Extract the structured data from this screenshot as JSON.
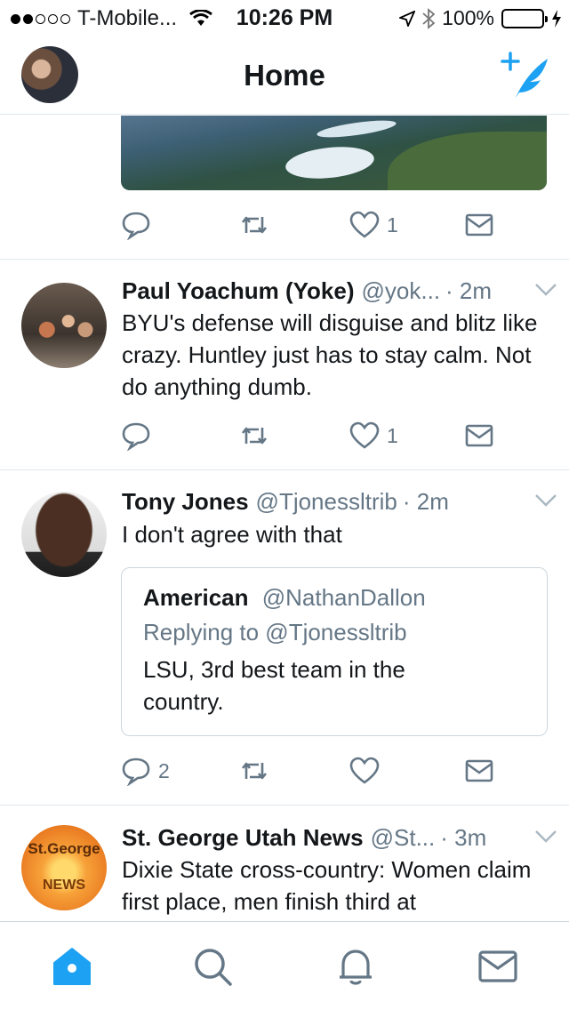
{
  "status_bar": {
    "carrier": "T-Mobile...",
    "time": "10:26 PM",
    "battery": "100%"
  },
  "nav": {
    "title": "Home"
  },
  "top_tweet": {
    "like_count": "1"
  },
  "tweets": [
    {
      "name": "Paul Yoachum (Yoke)",
      "handle": "@yok...",
      "time": "· 2m",
      "body": "BYU's defense will disguise and blitz like crazy. Huntley just has to stay calm. Not do anything dumb.",
      "reply_count": "",
      "like_count": "1"
    },
    {
      "name": "Tony Jones",
      "handle": "@Tjonessltrib",
      "time": "· 2m",
      "body": "I don't agree with that",
      "reply_count": "2",
      "like_count": "",
      "quote": {
        "name": "American",
        "handle": "@NathanDallon",
        "replying": "Replying to @Tjonessltrib",
        "body": "LSU, 3rd best team in the country."
      }
    },
    {
      "name": "St. George Utah News",
      "handle": "@St...",
      "time": "· 3m",
      "body": "Dixie State cross-country: Women claim first place, men finish third at",
      "avatar_text_top": "St.George",
      "avatar_text_bottom": "NEWS"
    }
  ],
  "colors": {
    "accent": "#1da1f2",
    "secondary_text": "#657786",
    "battery": "#4cd964"
  },
  "tabs": [
    "home-icon",
    "search-icon",
    "notifications-icon",
    "messages-icon"
  ]
}
